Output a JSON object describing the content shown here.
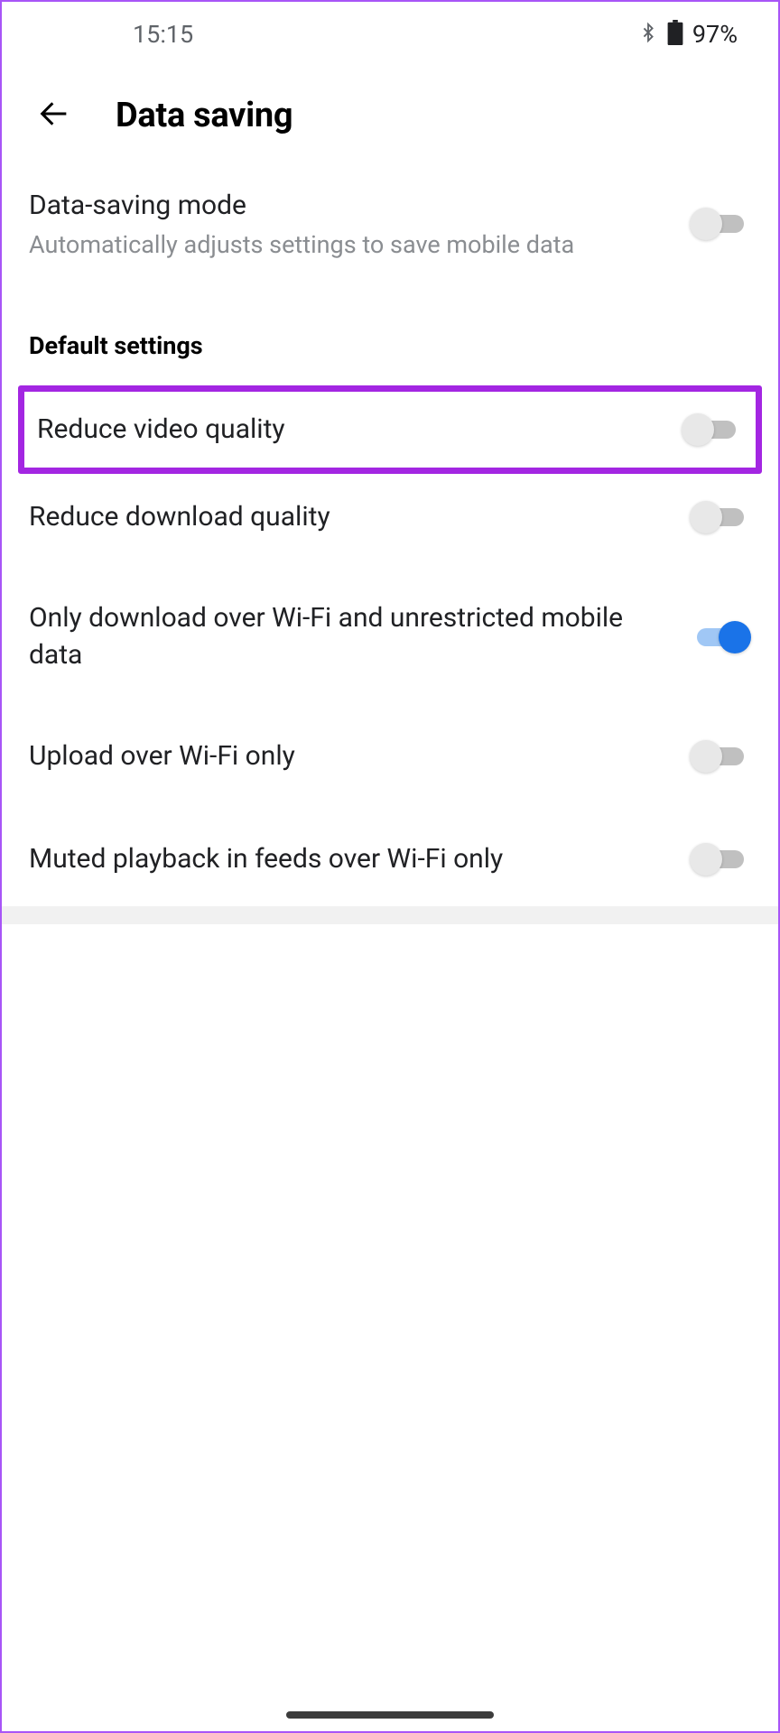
{
  "statusBar": {
    "time": "15:15",
    "batteryPercent": "97%"
  },
  "header": {
    "title": "Data saving"
  },
  "dataSavingMode": {
    "title": "Data-saving mode",
    "subtitle": "Automatically adjusts settings to save mobile data",
    "enabled": false
  },
  "sectionHeader": "Default settings",
  "settings": [
    {
      "key": "reduce-video-quality",
      "title": "Reduce video quality",
      "enabled": false,
      "highlighted": true
    },
    {
      "key": "reduce-download-quality",
      "title": "Reduce download quality",
      "enabled": false
    },
    {
      "key": "only-download-wifi",
      "title": "Only download over Wi-Fi and unrestricted mobile data",
      "enabled": true
    },
    {
      "key": "upload-wifi-only",
      "title": "Upload over Wi-Fi only",
      "enabled": false
    },
    {
      "key": "muted-playback-wifi",
      "title": "Muted playback in feeds over Wi-Fi only",
      "enabled": false
    }
  ]
}
